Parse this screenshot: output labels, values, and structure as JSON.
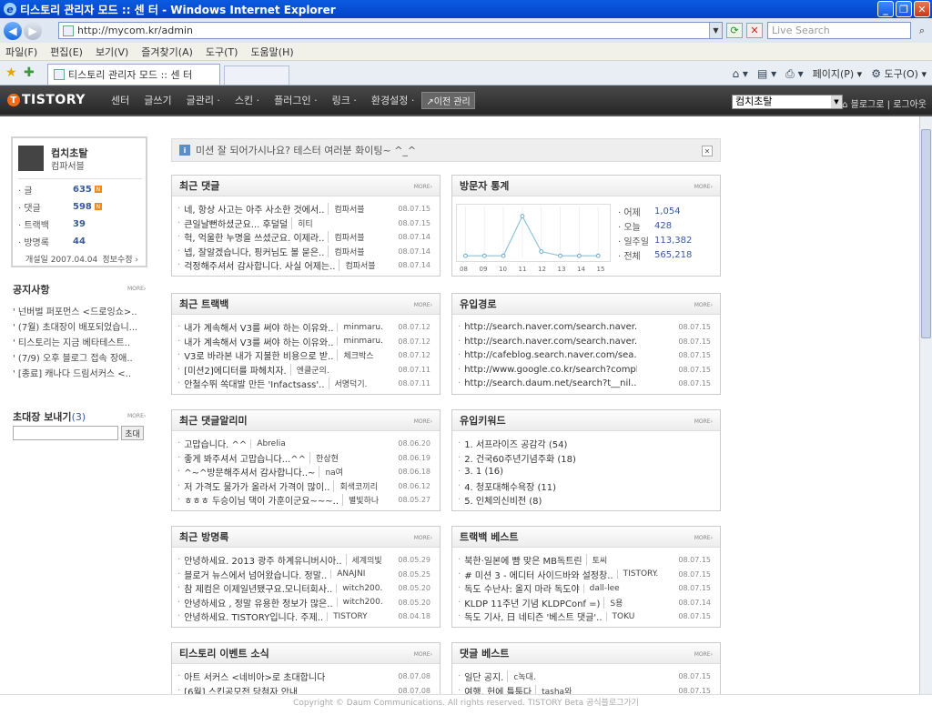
{
  "window": {
    "title": "티스토리 관리자 모드 :: 센 터 - Windows Internet Explorer"
  },
  "browser": {
    "url": "http://mycom.kr/admin",
    "search_placeholder": "Live Search",
    "menu": [
      "파일(F)",
      "편집(E)",
      "보기(V)",
      "즐겨찾기(A)",
      "도구(T)",
      "도움말(H)"
    ],
    "tab_title": "티스토리 관리자 모드 :: 센 터",
    "tools": {
      "page": "페이지(P)",
      "tools": "도구(O)"
    }
  },
  "topnav": {
    "logo": "TISTORY",
    "items": [
      "센터",
      "글쓰기",
      "글관리 ·",
      "스킨 ·",
      "플러그인 ·",
      "링크 ·",
      "환경설정 ·"
    ],
    "prev_manager": "↗이전 관리",
    "blog_select": "컴치초탈",
    "to_blog": "⌂ 블로그로",
    "logout": "로그아웃"
  },
  "profile": {
    "name": "컴치초탈",
    "subtitle": "컴파서블",
    "stats": [
      {
        "label": "· 글",
        "value": "635",
        "new": true
      },
      {
        "label": "· 댓글",
        "value": "598",
        "new": true
      },
      {
        "label": "· 트랙백",
        "value": "39",
        "new": false
      },
      {
        "label": "· 방명록",
        "value": "44",
        "new": false
      }
    ],
    "opened": "개설일 2007.04.04",
    "info": "정보수정 ›"
  },
  "sidebar": {
    "notice_title": "공지사항",
    "more": "MORE›",
    "notices": [
      "' 넌버벌 퍼포먼스 <드로잉쇼>..",
      "' (7월) 초대장이 배포되었습니...",
      "' 티스토리는 지금 베타테스트..",
      "' (7/9) 오후 블로그 접속 장애..",
      "' [종료] 캐나다 드림서커스 <.."
    ],
    "invite_title": "초대장 보내기",
    "invite_count": "(3)",
    "invite_button": "초대"
  },
  "mission": {
    "text": "미션 잘 되어가시나요? 테스터 여러분 화이팅~ ^_^"
  },
  "panels": {
    "recent_comments": {
      "title": "최근 댓글",
      "more": "MORE›",
      "items": [
        {
          "t": "네, 항상 사고는 아주 사소한 것에서..",
          "a": "컴파서블",
          "d": "08.07.15"
        },
        {
          "t": "큰일날뻔하셨군요... 후덜덜",
          "a": "히티",
          "d": "08.07.15"
        },
        {
          "t": "헉, 억울한 누명을 쓰셨군요. 이제라..",
          "a": "컴파서블",
          "d": "08.07.14"
        },
        {
          "t": "넵, 잘알겠습니다, 핑커님도 볼 묻은..",
          "a": "컴파서블",
          "d": "08.07.14"
        },
        {
          "t": "걱정해주셔서 감사합니다. 사실 어제는..",
          "a": "컴파서블",
          "d": "08.07.14"
        }
      ]
    },
    "visitors": {
      "title": "방문자 통계",
      "more": "MORE›",
      "stats": [
        {
          "k": "· 어제",
          "v": "1,054"
        },
        {
          "k": "· 오늘",
          "v": "428"
        },
        {
          "k": "· 일주일",
          "v": "113,382"
        },
        {
          "k": "· 전체",
          "v": "565,218"
        }
      ]
    },
    "recent_trackbacks": {
      "title": "최근 트랙백",
      "more": "MORE›",
      "items": [
        {
          "t": "내가 계속해서 V3를 써야 하는 이유와..",
          "a": "minmaru.",
          "d": "08.07.12"
        },
        {
          "t": "내가 계속해서 V3를 써야 하는 이유와..",
          "a": "minmaru.",
          "d": "08.07.12"
        },
        {
          "t": "V3로 바라본 내가 지불한 비용으로 받..",
          "a": "체크박스",
          "d": "08.07.12"
        },
        {
          "t": "[미션2]에디터를 파헤치자.",
          "a": "엔클군의.",
          "d": "08.07.11"
        },
        {
          "t": "안철수뛰 쏙대발 만든 'Infactsass'..",
          "a": "서명덕기.",
          "d": "08.07.11"
        }
      ]
    },
    "referrers": {
      "title": "유입경로",
      "more": "MORE›",
      "items": [
        {
          "t": "http://search.naver.com/search.naver..",
          "d": "08.07.15"
        },
        {
          "t": "http://search.naver.com/search.naver..",
          "d": "08.07.15"
        },
        {
          "t": "http://cafeblog.search.naver.com/sea..",
          "d": "08.07.15"
        },
        {
          "t": "http://www.google.co.kr/search?compl..",
          "d": "08.07.15"
        },
        {
          "t": "http://search.daum.net/search?t__nil..",
          "d": "08.07.15"
        }
      ]
    },
    "recent_reply_alerts": {
      "title": "최근 댓글알리미",
      "more": "MORE›",
      "items": [
        {
          "t": "고맙습니다. ^^",
          "a": "Abrelia",
          "d": "08.06.20"
        },
        {
          "t": "좋게 봐주셔서 고맙습니다...^^",
          "a": "한상현",
          "d": "08.06.19"
        },
        {
          "t": "^~^방문해주셔서 감사합니다..~",
          "a": "na여",
          "d": "08.06.18"
        },
        {
          "t": "저 가격도 물가가 올라서 가격이 많이..",
          "a": "회색코끼리",
          "d": "08.06.12"
        },
        {
          "t": "ㅎㅎㅎ 두승이님 댁이 가훈이군요~~~..",
          "a": "별빛하나",
          "d": "08.05.27"
        }
      ]
    },
    "keywords": {
      "title": "유입키워드",
      "more": "MORE›",
      "items": [
        {
          "t": "1. 서프라이즈 공감각 (54)"
        },
        {
          "t": "2. 건국60주년기념주화 (18)"
        },
        {
          "t": "3. 1 (16)"
        },
        {
          "t": "4. 청포대해수욕장 (11)"
        },
        {
          "t": "5. 인체의신비전 (8)"
        }
      ]
    },
    "recent_guestbook": {
      "title": "최근 방명록",
      "more": "MORE›",
      "items": [
        {
          "t": "안녕하세요. 2013 광주 하계유니버시아..",
          "a": "세계의빛",
          "d": "08.05.29"
        },
        {
          "t": "블로거 뉴스에서 넘어왔습니다. 정말..",
          "a": "ANAJNI",
          "d": "08.05.25"
        },
        {
          "t": "참 제컴은 이제일년됐구요.모니터회사..",
          "a": "witch200.",
          "d": "08.05.20"
        },
        {
          "t": "안녕하세요 , 정말 유용한 정보가 많은..",
          "a": "witch200.",
          "d": "08.05.20"
        },
        {
          "t": "안녕하세요. TISTORY입니다. 주제..",
          "a": "TISTORY",
          "d": "08.04.18"
        }
      ]
    },
    "trackback_best": {
      "title": "트랙백 베스트",
      "more": "MORE›",
      "items": [
        {
          "t": "북한·일본에 뺨 맞은 MB독트린",
          "a": "토씨",
          "d": "08.07.15"
        },
        {
          "t": "# 미션 3 - 에디터 사이드바와 설정창..",
          "a": "TISTORY.",
          "d": "08.07.15"
        },
        {
          "t": "독도 수난사: 올지 마라 독도야",
          "a": "dall-lee",
          "d": "08.07.15"
        },
        {
          "t": "KLDP 11주년 기념 KLDPConf =)",
          "a": "S용",
          "d": "08.07.14"
        },
        {
          "t": "독도 기사, 日 네티즌 '베스트 댓글'..",
          "a": "TOKU",
          "d": "08.07.15"
        }
      ]
    },
    "tistory_events": {
      "title": "티스토리 이벤트 소식",
      "more": "MORE›",
      "items": [
        {
          "t": "아트 서커스 <네비아>로 초대합니다",
          "d": "08.07.08"
        },
        {
          "t": "[6월] 스킨공모전 당첨자 안내",
          "d": "08.07.08"
        }
      ]
    },
    "comment_best": {
      "title": "댓글 베스트",
      "more": "MORE›",
      "items": [
        {
          "t": "일단 공지.",
          "a": "c녹대.",
          "d": "08.07.15"
        },
        {
          "t": "여행, 헌에 틀툼다",
          "a": "tasha와",
          "d": "08.07.15"
        }
      ]
    }
  },
  "footer": {
    "copyright": "Copyright © Daum Communications. All rights reserved. TISTORY Beta 공식블로그가기"
  },
  "colors": {
    "accent": "#3a5a9a",
    "nav_bg": "#333333",
    "logo": "#f26a1b"
  }
}
